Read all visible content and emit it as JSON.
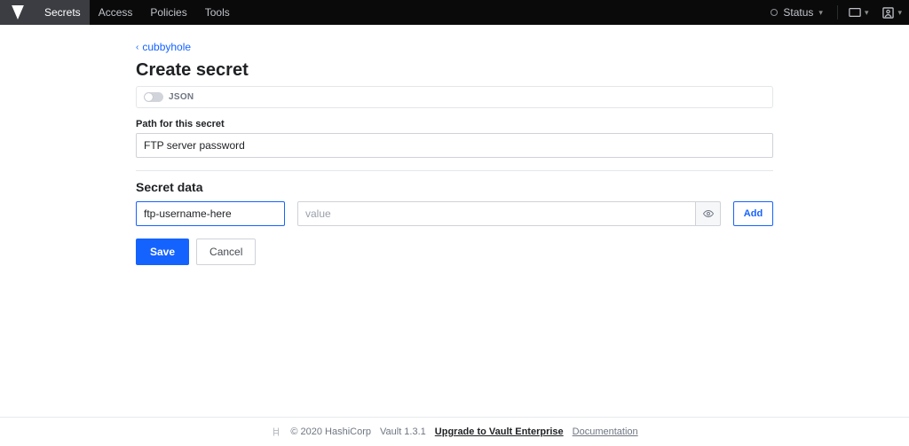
{
  "nav": {
    "items": [
      "Secrets",
      "Access",
      "Policies",
      "Tools"
    ],
    "status_label": "Status"
  },
  "breadcrumb": {
    "parent": "cubbyhole"
  },
  "page_title": "Create secret",
  "json_toggle": {
    "label": "JSON"
  },
  "path_field": {
    "label": "Path for this secret",
    "value": "FTP server password"
  },
  "secret_data": {
    "title": "Secret data",
    "rows": [
      {
        "key": "ftp-username-here",
        "value_placeholder": "value"
      }
    ],
    "add_label": "Add"
  },
  "actions": {
    "save": "Save",
    "cancel": "Cancel"
  },
  "footer": {
    "copyright": "© 2020 HashiCorp",
    "version": "Vault 1.3.1",
    "upgrade": "Upgrade to Vault Enterprise",
    "docs": "Documentation"
  }
}
